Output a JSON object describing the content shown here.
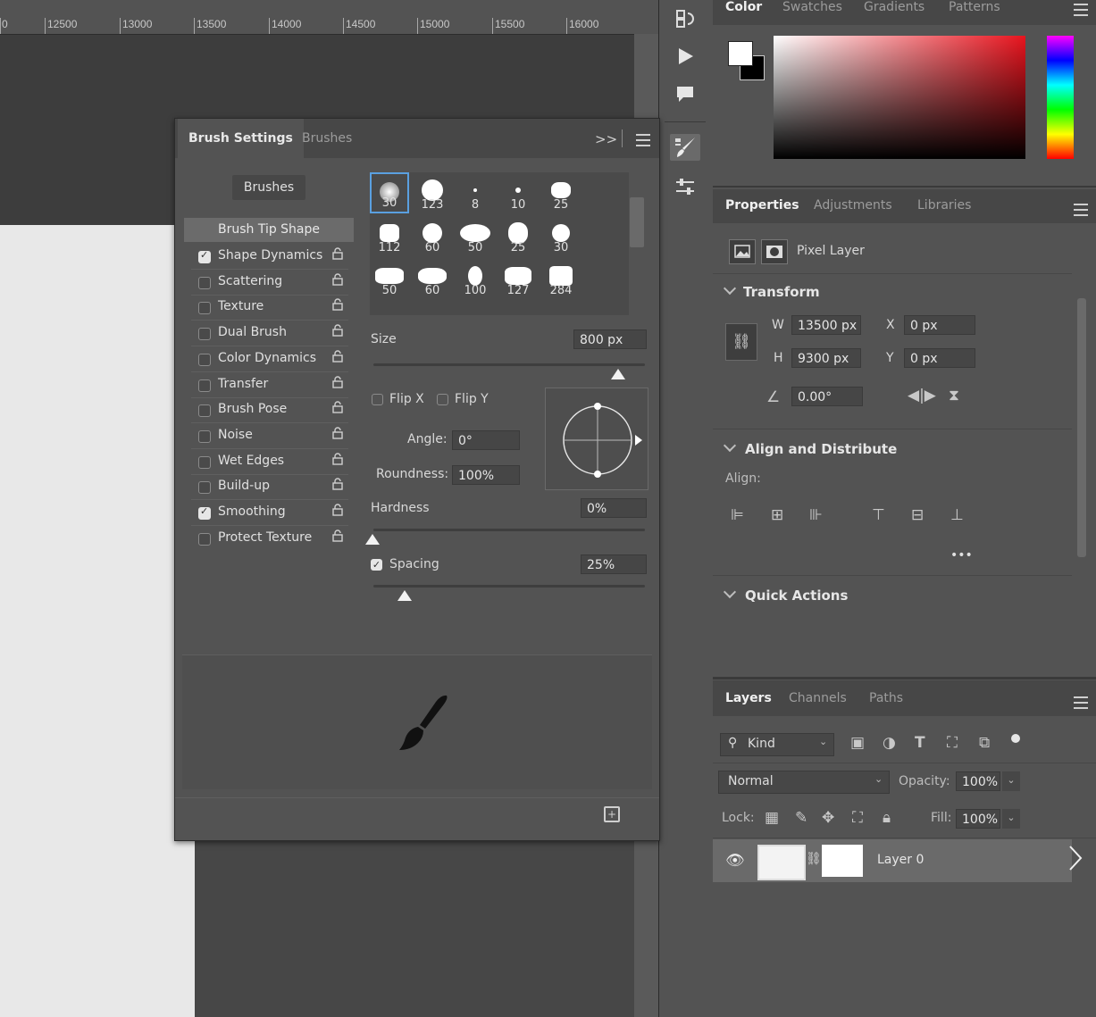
{
  "ruler": {
    "labels": [
      "12500",
      "13000",
      "13500",
      "14000",
      "14500",
      "15000",
      "15500",
      "16000"
    ]
  },
  "brush_panel": {
    "tabs": [
      "Brush Settings",
      "Brushes"
    ],
    "brushes_button": "Brushes",
    "tip_shape_label": "Brush Tip Shape",
    "options": [
      {
        "label": "Shape Dynamics",
        "checked": true
      },
      {
        "label": "Scattering",
        "checked": false
      },
      {
        "label": "Texture",
        "checked": false
      },
      {
        "label": "Dual Brush",
        "checked": false
      },
      {
        "label": "Color Dynamics",
        "checked": false
      },
      {
        "label": "Transfer",
        "checked": false
      },
      {
        "label": "Brush Pose",
        "checked": false
      },
      {
        "label": "Noise",
        "checked": false
      },
      {
        "label": "Wet Edges",
        "checked": false
      },
      {
        "label": "Build-up",
        "checked": false
      },
      {
        "label": "Smoothing",
        "checked": true
      },
      {
        "label": "Protect Texture",
        "checked": false
      }
    ],
    "presets": [
      "30",
      "123",
      "8",
      "10",
      "25",
      "112",
      "60",
      "50",
      "25",
      "30",
      "50",
      "60",
      "100",
      "127",
      "284"
    ],
    "size_label": "Size",
    "size_value": "800 px",
    "size_level": 0.9,
    "flip_x": "Flip X",
    "flip_y": "Flip Y",
    "angle_label": "Angle:",
    "angle_value": "0°",
    "roundness_label": "Roundness:",
    "roundness_value": "100%",
    "hardness_label": "Hardness",
    "hardness_value": "0%",
    "spacing_label": "Spacing",
    "spacing_value": "25%"
  },
  "color_panel": {
    "tabs": [
      "Color",
      "Swatches",
      "Gradients",
      "Patterns"
    ]
  },
  "properties_panel": {
    "tabs": [
      "Properties",
      "Adjustments",
      "Libraries"
    ],
    "layer_type": "Pixel Layer",
    "transform_title": "Transform",
    "w_label": "W",
    "w_value": "13500 px",
    "h_label": "H",
    "h_value": "9300 px",
    "x_label": "X",
    "x_value": "0 px",
    "y_label": "Y",
    "y_value": "0 px",
    "angle_value": "0.00°",
    "align_title": "Align and Distribute",
    "align_label": "Align:",
    "more": "•••",
    "quick_actions_title": "Quick Actions"
  },
  "layers_panel": {
    "tabs": [
      "Layers",
      "Channels",
      "Paths"
    ],
    "filter_label": "Kind",
    "blend_mode": "Normal",
    "opacity_label": "Opacity:",
    "opacity_value": "100%",
    "lock_label": "Lock:",
    "fill_label": "Fill:",
    "fill_value": "100%",
    "layer_name": "Layer 0"
  }
}
